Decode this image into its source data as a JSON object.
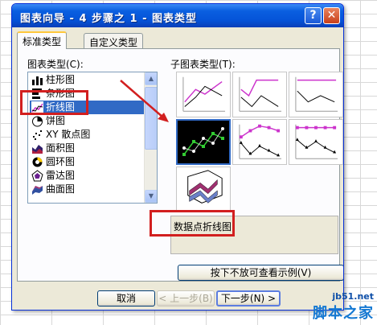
{
  "window": {
    "title": "图表向导 - 4 步骤之 1 - 图表类型",
    "help_label": "?",
    "close_label": "✕"
  },
  "tabs": [
    {
      "label": "标准类型",
      "active": true
    },
    {
      "label": "自定义类型",
      "active": false
    }
  ],
  "chart_type_label": "图表类型(C):",
  "chart_types": [
    {
      "label": "柱形图",
      "icon": "column-chart-icon"
    },
    {
      "label": "条形图",
      "icon": "bar-chart-icon"
    },
    {
      "label": "折线图",
      "icon": "line-chart-icon",
      "selected": true
    },
    {
      "label": "饼图",
      "icon": "pie-chart-icon"
    },
    {
      "label": "XY 散点图",
      "icon": "scatter-chart-icon"
    },
    {
      "label": "面积图",
      "icon": "area-chart-icon"
    },
    {
      "label": "圆环图",
      "icon": "doughnut-chart-icon"
    },
    {
      "label": "雷达图",
      "icon": "radar-chart-icon"
    },
    {
      "label": "曲面图",
      "icon": "surface-chart-icon"
    }
  ],
  "subtype_label": "子图表类型(T):",
  "subtypes": [
    {
      "icon": "line-icon"
    },
    {
      "icon": "stacked-line-icon"
    },
    {
      "icon": "percent-stacked-line-icon"
    },
    {
      "icon": "line-with-markers-icon",
      "selected": true
    },
    {
      "icon": "stacked-line-with-markers-icon"
    },
    {
      "icon": "percent-stacked-line-with-markers-icon"
    },
    {
      "icon": "3d-line-icon"
    }
  ],
  "description": "数据点折线图",
  "preview_button": "按下不放可查看示例(V)",
  "buttons": {
    "cancel": "取消",
    "back": "< 上一步(B)",
    "next": "下一步(N) >"
  },
  "watermark": {
    "url": "jb51.net",
    "name": "脚本之家"
  },
  "colors": {
    "titlebar": "#0553d8",
    "selection": "#316ac5",
    "highlight": "#d21f1f",
    "series_1": "#cc33cc",
    "series_2": "#000000",
    "selected_line": "#33cc33"
  }
}
